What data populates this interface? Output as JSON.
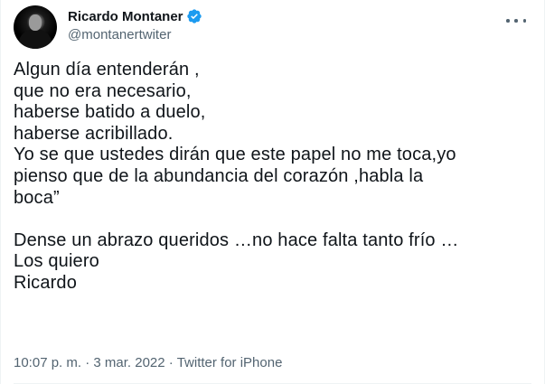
{
  "author": {
    "display_name": "Ricardo Montaner",
    "handle": "@montanertwiter",
    "verified": true,
    "verified_color": "#1d9bf0"
  },
  "tweet": {
    "lines": [
      "Algun día entenderán ,",
      "que no era necesario,",
      "haberse batido a duelo,",
      "haberse acribillado.",
      "Yo se que ustedes dirán que este papel no me toca,yo",
      "pienso que de la abundancia del corazón ,habla la",
      "boca”",
      "",
      "Dense un abrazo queridos …no hace falta tanto frío …",
      "Los quiero",
      "Ricardo"
    ]
  },
  "meta": {
    "time": "10:07 p. m.",
    "separator1": "·",
    "date": "3 mar. 2022",
    "separator2": "·",
    "source": "Twitter for iPhone"
  },
  "icons": {
    "avatar": "profile-photo",
    "verified": "verified-badge-icon",
    "more": "more-options-icon"
  }
}
